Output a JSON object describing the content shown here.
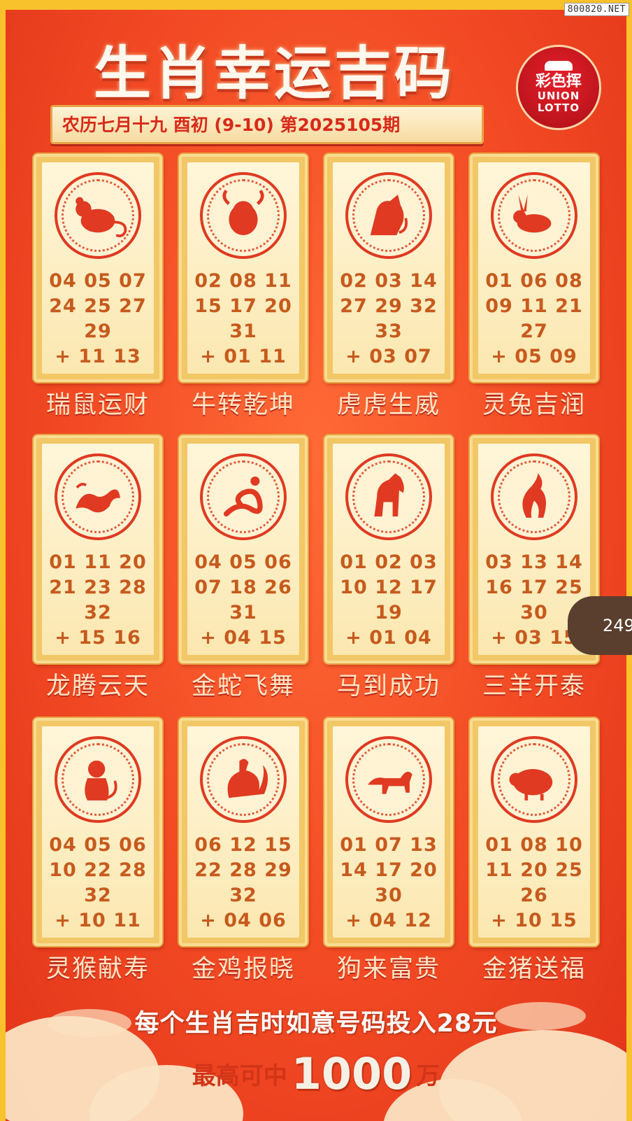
{
  "watermark": "800820.NET",
  "title": "生肖幸运吉码",
  "logo": {
    "line1": "彩色挥",
    "line2": "UNION",
    "line3": "LOTTO"
  },
  "subtitle": "农历七月十九 酉初 (9-10) 第2025105期",
  "side_badge": "249",
  "colors": {
    "background": "#f24a24",
    "card": "#fbe7b0",
    "number": "#c75a1e",
    "accent": "#e03a22"
  },
  "zodiacs": [
    {
      "icon": "rat-icon",
      "lines": [
        "04 05 07",
        "24 25 27",
        "29",
        "+ 11 13"
      ],
      "motto": "瑞鼠运财"
    },
    {
      "icon": "ox-icon",
      "lines": [
        "02 08 11",
        "15 17 20",
        "31",
        "+ 01 11"
      ],
      "motto": "牛转乾坤"
    },
    {
      "icon": "tiger-icon",
      "lines": [
        "02 03 14",
        "27 29 32",
        "33",
        "+ 03 07"
      ],
      "motto": "虎虎生威"
    },
    {
      "icon": "rabbit-icon",
      "lines": [
        "01 06 08",
        "09 11 21",
        "27",
        "+ 05 09"
      ],
      "motto": "灵兔吉润"
    },
    {
      "icon": "dragon-icon",
      "lines": [
        "01 11 20",
        "21 23 28",
        "32",
        "+ 15 16"
      ],
      "motto": "龙腾云天"
    },
    {
      "icon": "snake-icon",
      "lines": [
        "04 05 06",
        "07 18 26",
        "31",
        "+ 04 15"
      ],
      "motto": "金蛇飞舞"
    },
    {
      "icon": "horse-icon",
      "lines": [
        "01 02 03",
        "10 12 17",
        "19",
        "+ 01 04"
      ],
      "motto": "马到成功"
    },
    {
      "icon": "goat-icon",
      "lines": [
        "03 13 14",
        "16 17 25",
        "30",
        "+ 03 15"
      ],
      "motto": "三羊开泰"
    },
    {
      "icon": "monkey-icon",
      "lines": [
        "04 05 06",
        "10 22 28",
        "32",
        "+ 10 11"
      ],
      "motto": "灵猴献寿"
    },
    {
      "icon": "rooster-icon",
      "lines": [
        "06 12 15",
        "22 28 29",
        "32",
        "+ 04 06"
      ],
      "motto": "金鸡报晓"
    },
    {
      "icon": "dog-icon",
      "lines": [
        "01 07 13",
        "14 17 20",
        "30",
        "+ 04 12"
      ],
      "motto": "狗来富贵"
    },
    {
      "icon": "pig-icon",
      "lines": [
        "01 08 10",
        "11 20 25",
        "26",
        "+ 10 15"
      ],
      "motto": "金猪送福"
    }
  ],
  "footer": {
    "line1": "每个生肖吉时如意号码投入28元",
    "line2_pre": "最高可中",
    "line2_amount": "1000",
    "line2_post": "万"
  }
}
